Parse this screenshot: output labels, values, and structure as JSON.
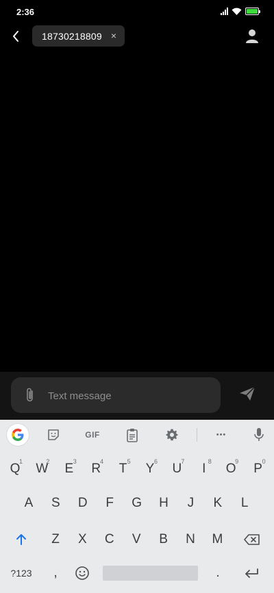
{
  "status_bar": {
    "time": "2:36",
    "battery_level": 1.0,
    "battery_color": "#3ddc3d"
  },
  "header": {
    "back_icon": "chevron-left-icon",
    "recipient": "18730218809",
    "chip_close": "×",
    "contact_icon": "person-icon"
  },
  "compose": {
    "placeholder": "Text message",
    "value": "",
    "attach_icon": "paperclip-icon",
    "send_icon": "send-icon"
  },
  "keyboard": {
    "toolbar": {
      "google": "G",
      "sticker_icon": "sticker-icon",
      "gif": "GIF",
      "clipboard_icon": "clipboard-icon",
      "settings_icon": "gear-icon",
      "more": "•••",
      "mic_icon": "mic-icon"
    },
    "row1": [
      "Q",
      "W",
      "E",
      "R",
      "T",
      "Y",
      "U",
      "I",
      "O",
      "P"
    ],
    "row1_hints": [
      "1",
      "2",
      "3",
      "4",
      "5",
      "6",
      "7",
      "8",
      "9",
      "0"
    ],
    "row2": [
      "A",
      "S",
      "D",
      "F",
      "G",
      "H",
      "J",
      "K",
      "L"
    ],
    "row3": [
      "Z",
      "X",
      "C",
      "V",
      "B",
      "N",
      "M"
    ],
    "shift_icon": "shift-icon",
    "backspace_icon": "backspace-icon",
    "bottom_row": {
      "symbols": "?123",
      "comma": ",",
      "emoji_icon": "emoji-icon",
      "period": ".",
      "enter_icon": "enter-icon"
    }
  },
  "colors": {
    "accent_blue": "#1a73e8",
    "keyboard_bg": "#e9eaec",
    "compose_bg": "#2b2b2b"
  }
}
